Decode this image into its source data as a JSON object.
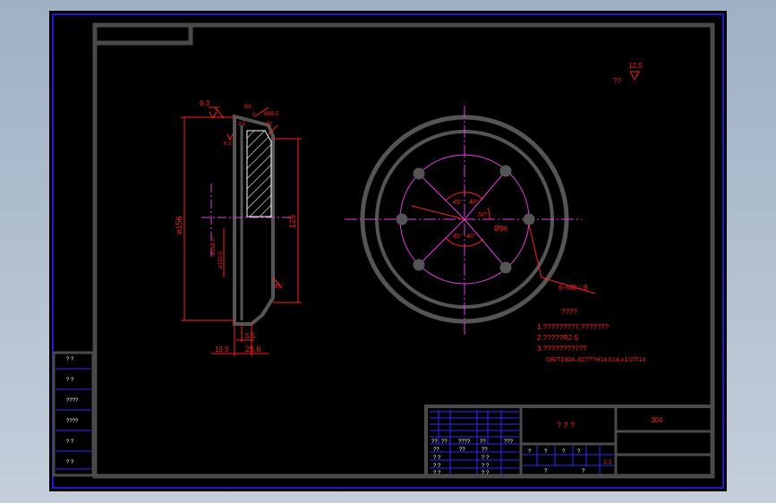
{
  "colors": {
    "background": "#000000",
    "frame": "#4a4a4a",
    "border_blue": "#1a1ad0",
    "dimension_red": "#ff2020",
    "centerline_magenta": "#e040e0",
    "table_blue": "#2b2bff",
    "table_text": "#ffffff"
  },
  "roughness": {
    "top_right_value": "12.5",
    "top_right_note": "??",
    "section_top": "6.3",
    "section_inner": "6.3",
    "chamfer_small": "R6",
    "chamfer_angle": "0",
    "top_dim_a": "Ø68.5",
    "top_dim_b": "2.5",
    "top_dim_c": "30"
  },
  "section_view": {
    "dia_outer": "ø156",
    "dia_inner": "125",
    "bore_a": "ø132.0",
    "bore_b": "ø132.0",
    "chamfer": "45°",
    "width_small": "5.5",
    "width_left": "19.5",
    "width_total": "25.6"
  },
  "plan_view": {
    "angle_tl": "45°",
    "angle_tr": "40°",
    "angle_right": "50°",
    "angle_bl": "45°",
    "angle_br": "40°",
    "bolt_circle": "Ø96",
    "holes_callout": "6–M8  ▽8"
  },
  "notes": {
    "heading": "????",
    "line1": "1.?????????,???????",
    "line2": "2.?????R2-5",
    "line3": "3.???????????",
    "line4": "GB/T1804–92???H14,h14,±1/2IT14"
  },
  "title_block": {
    "part_name": "? ? ?",
    "material": "304",
    "scale": "1:1",
    "row_labels": [
      "??",
      "??",
      "????",
      "??",
      "??"
    ],
    "sig_labels": [
      "? ?",
      "? ?",
      "? ?"
    ],
    "head_cells": [
      "??",
      "??",
      "????",
      "??",
      "???"
    ],
    "right_small": [
      "?",
      "?",
      "?",
      "?",
      "?",
      "?"
    ]
  },
  "side_panel": {
    "items": [
      "?  ?",
      "?  ?",
      "????",
      "????",
      "?  ?",
      "?  ?"
    ]
  }
}
